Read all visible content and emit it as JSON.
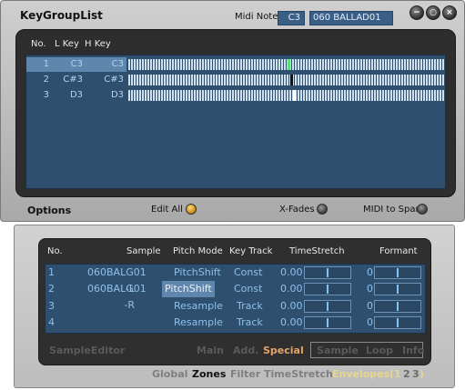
{
  "window": {
    "title": "KeyGroupList",
    "midi_note_label": "Midi Note",
    "midi_note_value": "C3",
    "midi_sample_value": "060 BALLAD01"
  },
  "keygroups": {
    "headers": {
      "no": "No.",
      "lkey": "L Key",
      "hkey": "H Key"
    },
    "rows": [
      {
        "no": "1",
        "lkey": "C3",
        "hkey": "C3",
        "marker_color": "#58e07a"
      },
      {
        "no": "2",
        "lkey": "C#3",
        "hkey": "C#3",
        "marker_color": "#111111"
      },
      {
        "no": "3",
        "lkey": "D3",
        "hkey": "D3",
        "marker_color": "#ffffff"
      }
    ]
  },
  "options": {
    "label": "Options",
    "edit_all": "Edit All",
    "xfades": "X-Fades",
    "midi_to_span": "MIDI to Span"
  },
  "samples": {
    "headers": {
      "no": "No.",
      "sample": "Sample",
      "pitch_mode": "Pitch Mode",
      "key_track": "Key Track",
      "timestretch": "TimeStretch",
      "formant": "Formant"
    },
    "rows": [
      {
        "no": "1",
        "sample": "060BALG01 -L",
        "pitch_mode": "PitchShift",
        "key_track": "Const",
        "timestretch": "0.00",
        "formant": "0"
      },
      {
        "no": "2",
        "sample": "060BALG01 -R",
        "pitch_mode": "PitchShift",
        "key_track": "Const",
        "timestretch": "0.00",
        "formant": "0"
      },
      {
        "no": "3",
        "sample": "",
        "pitch_mode": "Resample",
        "key_track": "Track",
        "timestretch": "0.00",
        "formant": "0"
      },
      {
        "no": "4",
        "sample": "",
        "pitch_mode": "Resample",
        "key_track": "Track",
        "timestretch": "0.00",
        "formant": "0"
      }
    ],
    "footer": {
      "sample_editor": "SampleEditor",
      "main": "Main",
      "add": "Add.",
      "special": "Special",
      "sample": "Sample",
      "loop": "Loop",
      "info": "Info"
    }
  },
  "tabs": {
    "global": "Global",
    "zones": "Zones",
    "filter": "Filter",
    "timestretch": "TimeStretch",
    "envelopes": "Envelopes",
    "open_paren": "(",
    "num1": "1",
    "num2": "2",
    "num3": "3",
    "close_paren": ")"
  }
}
